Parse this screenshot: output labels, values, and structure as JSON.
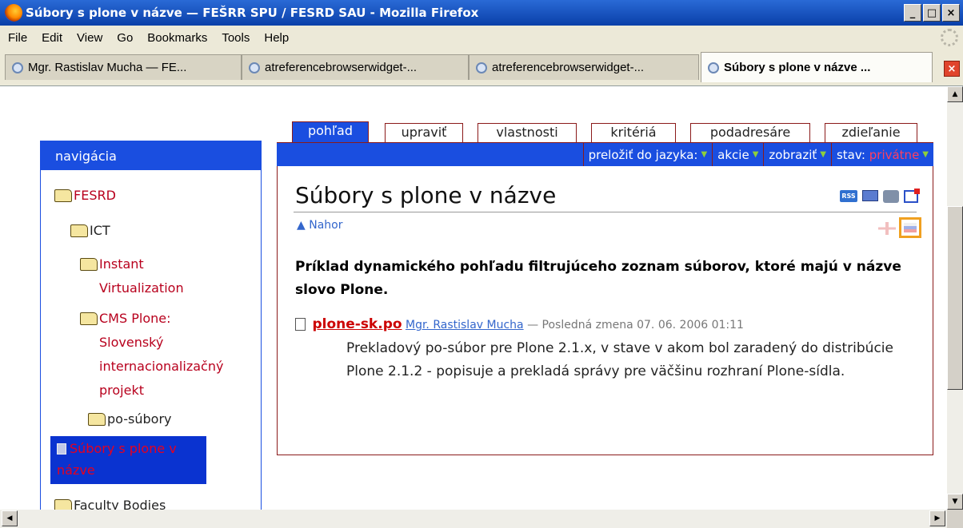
{
  "window": {
    "title": "Súbory s plone v názve — FEŠRR SPU / FESRD SAU - Mozilla Firefox",
    "minimize": "_",
    "maximize": "□",
    "close": "×"
  },
  "menu": [
    "File",
    "Edit",
    "View",
    "Go",
    "Bookmarks",
    "Tools",
    "Help"
  ],
  "tabs": [
    {
      "label": "Mgr. Rastislav Mucha — FE..."
    },
    {
      "label": "atreferencebrowserwidget-..."
    },
    {
      "label": "atreferencebrowserwidget-..."
    },
    {
      "label": "Súbory s plone v názve ..."
    }
  ],
  "nav": {
    "header": "navigácia",
    "items": [
      {
        "label": "FESRD"
      },
      {
        "label": "ICT"
      },
      {
        "label": "Instant\nVirtualization"
      },
      {
        "label": "CMS Plone:\nSlovenský\ninternacionalizačný\nprojekt"
      },
      {
        "label": "po-súbory"
      },
      {
        "label": "Súbory s plone v\nnázve"
      },
      {
        "label": "Faculty Bodies"
      }
    ]
  },
  "content_tabs": [
    "pohľad",
    "upraviť",
    "vlastnosti",
    "kritériá",
    "podadresáre",
    "zdieľanie"
  ],
  "actions": {
    "translate": "preložiť do jazyka:",
    "actions": "akcie",
    "display": "zobraziť",
    "state_label": "stav:",
    "state_value": "privátne"
  },
  "page": {
    "title": "Súbory s plone v názve",
    "up": "▲ Nahor",
    "rss": "RSS",
    "description": "Príklad dynamického pohľadu filtrujúceho zoznam súborov, ktoré majú v názve slovo Plone."
  },
  "item": {
    "name": "plone-sk.po",
    "author": "Mgr. Rastislav Mucha",
    "modified": "— Posledná zmena 07. 06. 2006 01:11",
    "description": "Prekladový po-súbor pre Plone 2.1.x, v stave v akom bol zaradený do distribúcie Plone 2.1.2 - popisuje a prekladá správy pre väčšinu rozhraní Plone-sídla."
  }
}
